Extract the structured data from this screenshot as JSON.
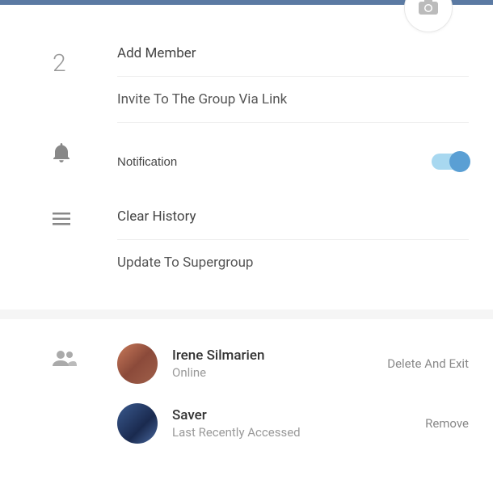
{
  "header": {
    "member_count": "2"
  },
  "actions": {
    "add_member": "Add Member",
    "invite_link": "Invite To The Group Via Link",
    "notification": "Notification",
    "clear_history": "Clear History",
    "update_supergroup": "Update To Supergroup"
  },
  "members": [
    {
      "name": "Irene Silmarien",
      "status": "Online",
      "action": "Delete And Exit"
    },
    {
      "name": "Saver",
      "status": "Last Recently Accessed",
      "action": "Remove"
    }
  ]
}
